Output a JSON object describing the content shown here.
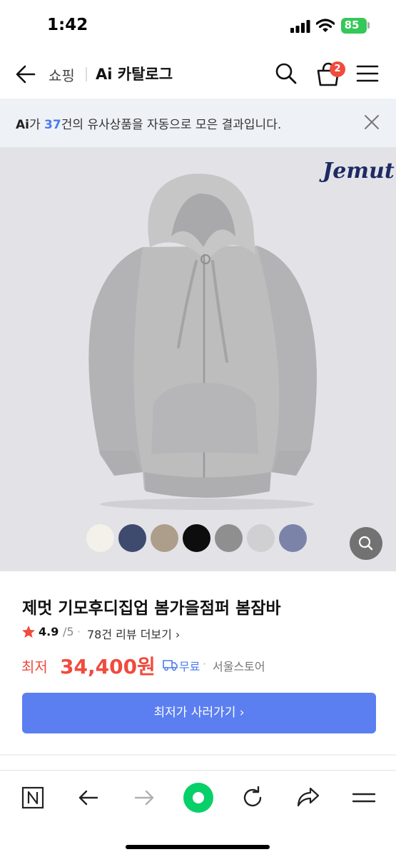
{
  "status_bar": {
    "time": "1:42",
    "battery": "85"
  },
  "header": {
    "back_icon": "arrow-left-icon",
    "shop_label": "쇼핑",
    "title": "Ai 카탈로그",
    "cart_count": "2",
    "icons": [
      "search-icon",
      "cart-icon",
      "menu-icon"
    ]
  },
  "ai_notice": {
    "ai_mark": "Ai",
    "text_1": "가 ",
    "count": "37",
    "text_2": "건의 유사상품을 자동으로 모은 결과입니다."
  },
  "product_image": {
    "brand_mark": "Jemut",
    "swatches": [
      "#f3f1ea",
      "#3e4a6e",
      "#ad9d8b",
      "#0d0d0d",
      "#8f8f8f",
      "#d0d0d2",
      "#7b84a8"
    ]
  },
  "product": {
    "title": "제멋 기모후디집업 봄가을점퍼 봄잠바",
    "rating": "4.9",
    "rating_max": "/5",
    "review_sep": "·",
    "review_link": "78건 리뷰 더보기 ›",
    "price_label": "최저",
    "price": "34,400원",
    "delivery": "무료",
    "delivery_sep": "·",
    "store": "서울스토어",
    "buy_button": "최저가 사러가기 ›"
  },
  "toolbar": {
    "icons": [
      "n-home-icon",
      "back-icon",
      "forward-icon",
      "green-dot-icon",
      "refresh-icon",
      "share-icon",
      "menu-icon"
    ]
  },
  "colors": {
    "accent": "#4b7bec",
    "price": "#f04b3d",
    "button": "#5b7ff0",
    "badge": "#f04b3d"
  }
}
